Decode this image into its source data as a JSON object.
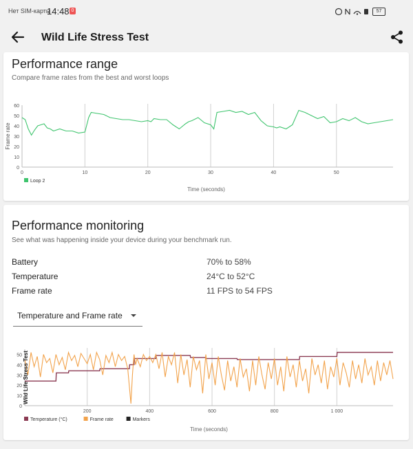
{
  "status_bar": {
    "carrier": "Нет SIM-карты",
    "time": "14:48",
    "notification_badge": "0",
    "battery": "57"
  },
  "app_bar": {
    "title": "Wild Life Stress Test"
  },
  "performance_range": {
    "title": "Performance range",
    "subtitle": "Compare frame rates from the best and worst loops"
  },
  "performance_monitoring": {
    "title": "Performance monitoring",
    "subtitle": "See what was happening inside your device during your benchmark run.",
    "metrics": [
      {
        "label": "Battery",
        "value": "70% to 58%"
      },
      {
        "label": "Temperature",
        "value": "24°C to 52°C"
      },
      {
        "label": "Frame rate",
        "value": "11 FPS to 54 FPS"
      }
    ],
    "dropdown": {
      "selected": "Temperature and Frame rate"
    }
  },
  "chart_data": [
    {
      "type": "line",
      "xlabel": "Time (seconds)",
      "ylabel": "Frame rate",
      "xlim": [
        0,
        59
      ],
      "ylim": [
        0,
        60
      ],
      "xticks": [
        "0",
        "10",
        "20",
        "30",
        "40",
        "50"
      ],
      "yticks": [
        "0",
        "10",
        "20",
        "30",
        "40",
        "50",
        "60"
      ],
      "vertical_markers": [
        10,
        20,
        30,
        40,
        50
      ],
      "legend": [
        {
          "name": "Loop 2",
          "color": "#3ec46d"
        }
      ],
      "series": [
        {
          "name": "Loop 2",
          "color": "#3ec46d",
          "x": [
            0,
            0.5,
            1,
            1.5,
            2,
            2.5,
            3,
            3.5,
            4,
            4.5,
            5,
            6,
            7,
            8,
            9,
            10,
            10.6,
            11,
            12,
            13,
            14,
            15,
            16,
            17,
            18,
            19,
            20,
            20.5,
            21,
            22,
            23,
            24,
            25,
            26,
            26.5,
            27,
            28,
            29,
            30,
            30.5,
            31,
            32,
            33,
            34,
            35,
            36,
            37,
            38,
            39,
            40,
            40.5,
            41,
            42,
            43,
            44,
            45,
            46,
            47,
            48,
            49,
            50,
            51,
            52,
            53,
            54,
            55,
            56,
            57,
            58,
            59
          ],
          "values": [
            48,
            46,
            37,
            31,
            36,
            40,
            41,
            42,
            38,
            37,
            35,
            37,
            35,
            35,
            33,
            34,
            48,
            53,
            52,
            51,
            48,
            47,
            46,
            46,
            45,
            44,
            45,
            44,
            47,
            46,
            46,
            41,
            37,
            42,
            44,
            45,
            48,
            43,
            41,
            37,
            53,
            54,
            55,
            53,
            54,
            51,
            53,
            45,
            40,
            39,
            38,
            39,
            37,
            41,
            55,
            53,
            50,
            47,
            49,
            43,
            44,
            47,
            45,
            48,
            44,
            42,
            43,
            44,
            45,
            46
          ]
        }
      ]
    },
    {
      "type": "line",
      "xlabel": "Time (seconds)",
      "ylabel": "Wild Life Stress Test",
      "xlim": [
        0,
        1180
      ],
      "ylim": [
        0,
        55
      ],
      "xticks": [
        "200",
        "400",
        "600",
        "800",
        "1 000"
      ],
      "yticks": [
        "0",
        "10",
        "20",
        "30",
        "40",
        "50"
      ],
      "vertical_markers": [
        200,
        400,
        600,
        800,
        1000
      ],
      "legend": [
        {
          "name": "Temperature (°C)",
          "color": "#8b3a52"
        },
        {
          "name": "Frame rate",
          "color": "#f2a24a"
        },
        {
          "name": "Markers",
          "color": "#222222"
        }
      ],
      "series": [
        {
          "name": "Temperature (°C)",
          "color": "#8b3a52",
          "x": [
            0,
            100,
            101,
            140,
            141,
            240,
            241,
            335,
            336,
            350,
            351,
            420,
            421,
            530,
            531,
            580,
            581,
            680,
            681,
            880,
            881,
            1000,
            1001,
            1180
          ],
          "values": [
            24,
            24,
            32,
            32,
            34,
            34,
            36,
            36,
            40,
            40,
            46,
            46,
            49,
            49,
            47,
            47,
            46,
            46,
            45,
            45,
            48,
            48,
            52,
            52
          ]
        },
        {
          "name": "Frame rate",
          "color": "#f2a24a",
          "x": [
            0,
            10,
            20,
            30,
            40,
            50,
            60,
            70,
            80,
            90,
            100,
            110,
            120,
            130,
            140,
            150,
            160,
            170,
            180,
            190,
            200,
            210,
            220,
            230,
            240,
            250,
            260,
            270,
            280,
            290,
            300,
            310,
            320,
            330,
            340,
            345,
            350,
            355,
            360,
            370,
            380,
            390,
            400,
            410,
            420,
            430,
            440,
            450,
            460,
            470,
            480,
            490,
            500,
            510,
            520,
            530,
            540,
            550,
            560,
            570,
            580,
            590,
            600,
            610,
            620,
            630,
            640,
            650,
            660,
            670,
            680,
            690,
            700,
            710,
            720,
            730,
            740,
            750,
            760,
            770,
            780,
            790,
            800,
            810,
            820,
            830,
            840,
            850,
            860,
            870,
            880,
            890,
            900,
            910,
            920,
            930,
            940,
            950,
            960,
            970,
            980,
            990,
            1000,
            1010,
            1020,
            1030,
            1040,
            1050,
            1060,
            1070,
            1080,
            1090,
            1100,
            1110,
            1120,
            1130,
            1140,
            1150,
            1160,
            1170,
            1180
          ],
          "values": [
            45,
            30,
            52,
            38,
            48,
            28,
            50,
            42,
            46,
            32,
            50,
            40,
            47,
            35,
            52,
            44,
            49,
            38,
            51,
            46,
            41,
            50,
            35,
            52,
            45,
            30,
            49,
            42,
            52,
            38,
            50,
            44,
            48,
            36,
            2,
            30,
            50,
            40,
            46,
            38,
            50,
            44,
            48,
            42,
            50,
            36,
            52,
            28,
            48,
            40,
            52,
            22,
            50,
            30,
            45,
            18,
            48,
            35,
            44,
            12,
            50,
            26,
            42,
            20,
            48,
            30,
            15,
            44,
            24,
            38,
            18,
            46,
            28,
            36,
            14,
            44,
            20,
            48,
            30,
            16,
            42,
            26,
            46,
            20,
            38,
            14,
            48,
            28,
            40,
            18,
            44,
            24,
            36,
            12,
            46,
            30,
            40,
            22,
            44,
            16,
            38,
            28,
            46,
            20,
            42,
            32,
            18,
            44,
            26,
            40,
            22,
            46,
            30,
            38,
            20,
            44,
            24,
            42,
            30,
            44,
            26
          ]
        }
      ]
    }
  ]
}
